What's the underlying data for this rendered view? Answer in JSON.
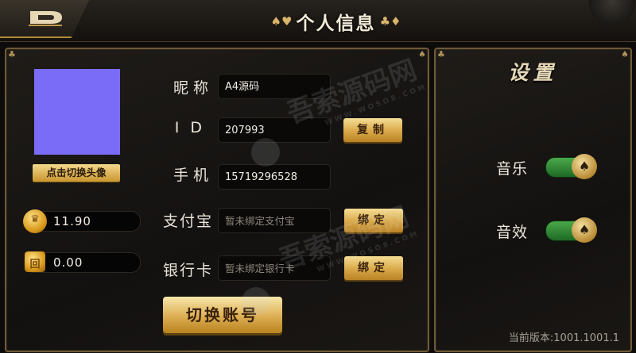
{
  "header": {
    "title": "个人信息",
    "suits_left": "♠♥",
    "suits_right": "♣♦"
  },
  "profile": {
    "avatar_button": "点击切换头像",
    "gold": "11.90",
    "card_balance": "0.00",
    "gold_icon_glyph": "♛",
    "card_icon_glyph": "回"
  },
  "fields": {
    "nickname": {
      "label": "昵称",
      "value": "A4源码"
    },
    "id": {
      "label": "ID",
      "value": "207993",
      "button": "复制"
    },
    "phone": {
      "label": "手机",
      "value": "15719296528"
    },
    "alipay": {
      "label": "支付宝",
      "placeholder": "暂未绑定支付宝",
      "button": "绑定"
    },
    "bank": {
      "label": "银行卡",
      "placeholder": "暂未绑定银行卡",
      "button": "绑定"
    }
  },
  "switch_account": "切换账号",
  "watermark": {
    "text": "吾索源码网",
    "url": "WWW.WOSO8.COM"
  },
  "settings": {
    "title": "设置",
    "music": {
      "label": "音乐",
      "on": true
    },
    "sound": {
      "label": "音效",
      "on": true
    },
    "toggle_glyph": "♠"
  },
  "version": "当前版本:1001.1001.1",
  "colors": {
    "gold": "#d9a849",
    "toggle_on": "#3f9b3f",
    "avatar": "#7b6cf8"
  },
  "icons": [
    "back-icon",
    "crown-coin-icon",
    "card-icon",
    "spade-icon"
  ]
}
